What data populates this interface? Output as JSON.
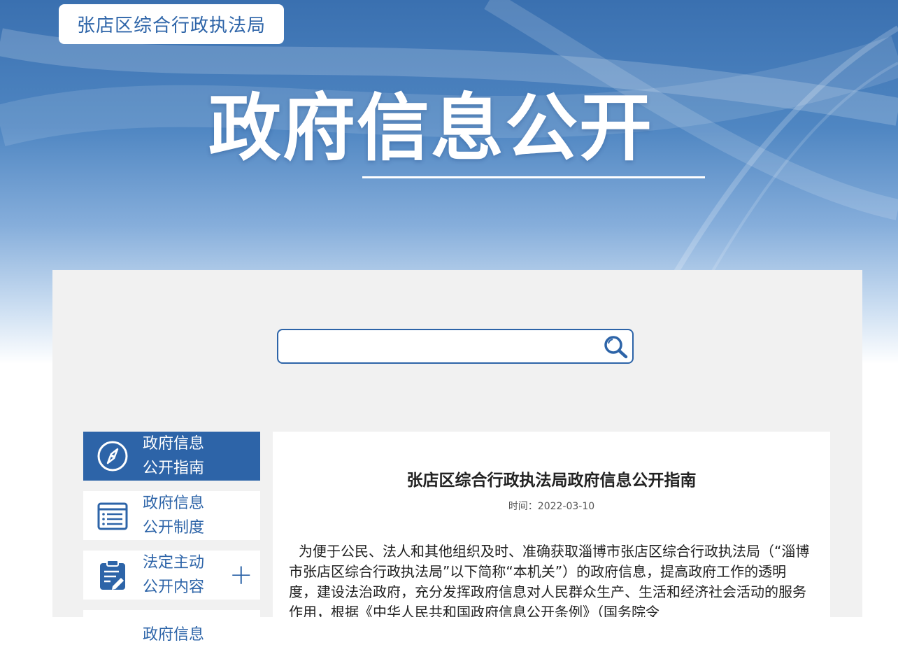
{
  "header": {
    "org_name": "张店区综合行政执法局",
    "title": "政府信息公开"
  },
  "search": {
    "value": "",
    "placeholder": "",
    "icon": "search-icon"
  },
  "sidebar": {
    "items": [
      {
        "label_line1": "政府信息",
        "label_line2": "公开指南",
        "icon": "compass-icon",
        "active": true
      },
      {
        "label_line1": "政府信息",
        "label_line2": "公开制度",
        "icon": "list-icon",
        "active": false
      },
      {
        "label_line1": "法定主动",
        "label_line2": "公开内容",
        "icon": "clipboard-edit-icon",
        "active": false,
        "expand": "+"
      },
      {
        "label_line1": "政府信息",
        "label_line2": "",
        "icon": "doc-icon",
        "active": false
      }
    ]
  },
  "article": {
    "title": "张店区综合行政执法局政府信息公开指南",
    "time": "时间：2022-03-10",
    "body": "为便于公民、法人和其他组织及时、准确获取淄博市张店区综合行政执法局（“淄博市张店区综合行政执法局”以下简称“本机关”）的政府信息，提高政府工作的透明度，建设法治政府，充分发挥政府信息对人民群众生产、生活和经济社会活动的服务作用，根据《中华人民共和国政府信息公开条例》（国务院令"
  },
  "colors": {
    "brand": "#2d64a8",
    "panel_bg": "#f1f1f1"
  }
}
